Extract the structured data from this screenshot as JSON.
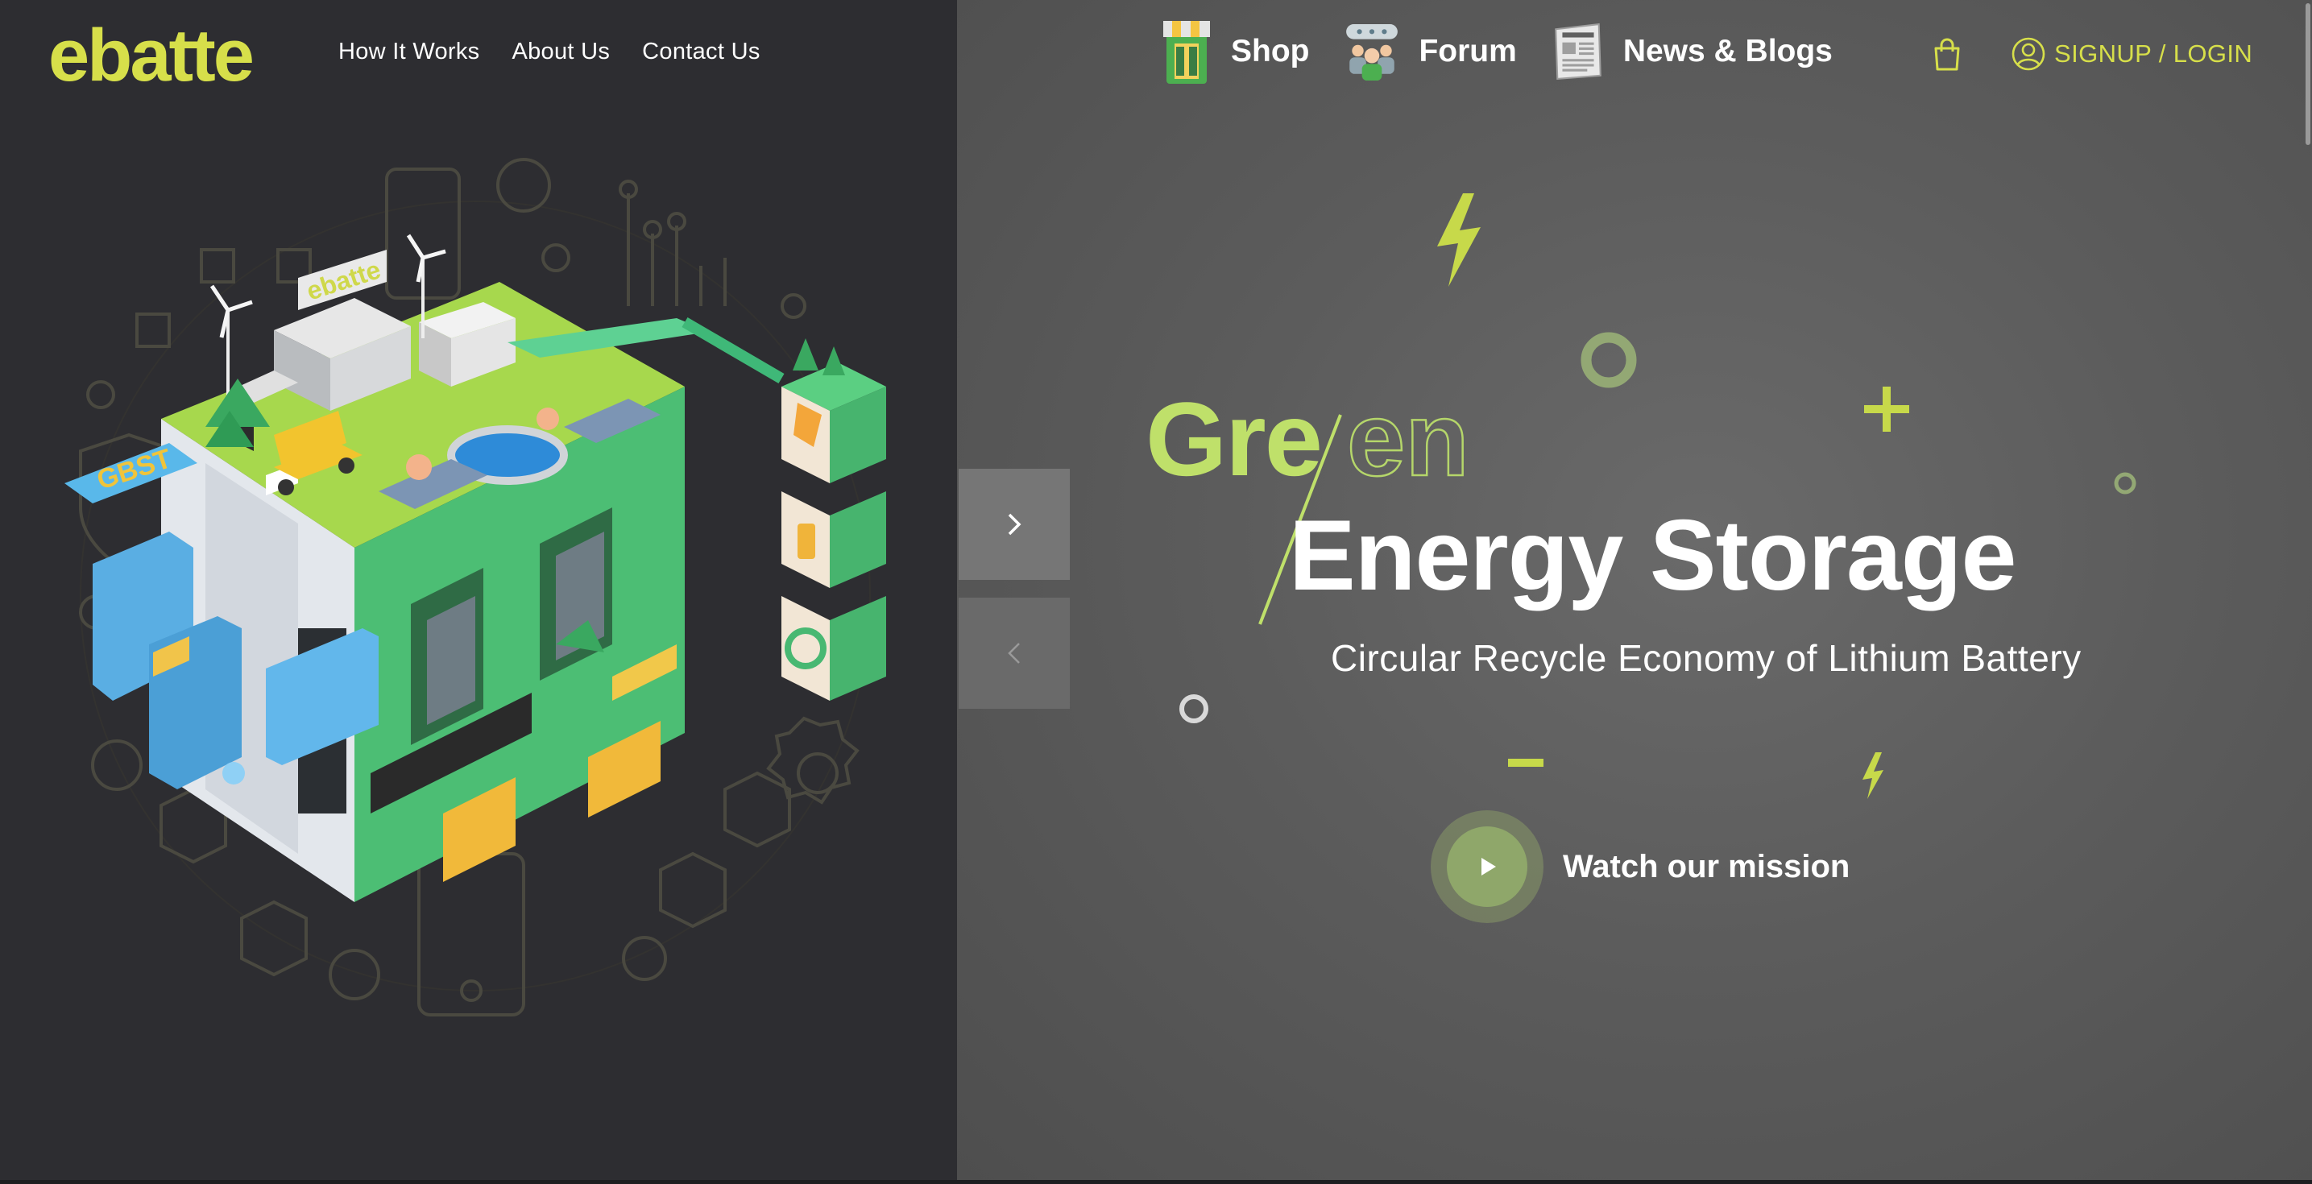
{
  "brand": {
    "logo_text": "ebatte",
    "accent_color": "#d7df4a"
  },
  "header": {
    "nav_links": [
      {
        "label": "How It Works"
      },
      {
        "label": "About Us"
      },
      {
        "label": "Contact Us"
      }
    ],
    "top_nav": [
      {
        "label": "Shop",
        "icon": "shop-icon"
      },
      {
        "label": "Forum",
        "icon": "forum-icon"
      },
      {
        "label": "News & Blogs",
        "icon": "newspaper-icon"
      }
    ],
    "cart_icon": "shopping-bag-icon",
    "account": {
      "label": "SIGNUP / LOGIN",
      "icon": "user-circle-icon"
    }
  },
  "carousel": {
    "next_icon": "chevron-right-icon",
    "prev_icon": "chevron-left-icon"
  },
  "hero": {
    "word_part_1": "Gre",
    "word_part_2": "en",
    "title": "Energy Storage",
    "subtitle": "Circular Recycle Economy of Lithium Battery",
    "cta_label": "Watch our mission",
    "cta_icon": "play-icon"
  },
  "illustration": {
    "sign_text": "GBST",
    "building_logo": "ebatte"
  }
}
